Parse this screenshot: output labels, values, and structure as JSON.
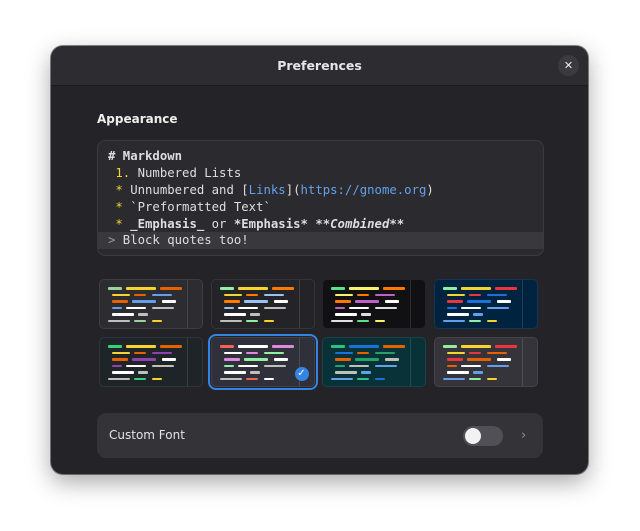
{
  "window": {
    "title": "Preferences",
    "close_icon": "close-icon"
  },
  "appearance": {
    "section_title": "Appearance",
    "preview": {
      "line1": "# Markdown",
      "line2_num": "1.",
      "line2_text": " Numbered Lists",
      "line3_bullet": "*",
      "line3_text_a": " Unnumbered and [",
      "line3_link_text": "Links",
      "line3_text_b": "](",
      "line3_url": "https://gnome.org",
      "line3_text_c": ")",
      "line4_bullet": "*",
      "line4_text": " `Preformatted Text`",
      "line5_bullet": "*",
      "line5_em": " _Emphasis_",
      "line5_or": " or ",
      "line5_strong": "*Emphasis*",
      "line5_combined": " **Combined**",
      "line6_mark": ">",
      "line6_text": " Block quotes too!"
    },
    "schemes": [
      {
        "background": "#2d2d31",
        "selected": false
      },
      {
        "background": "#242428",
        "selected": false
      },
      {
        "background": "#111113",
        "selected": false
      },
      {
        "background": "#002440",
        "selected": false
      },
      {
        "background": "#1f2428",
        "selected": false
      },
      {
        "background": "#30303a",
        "selected": true
      },
      {
        "background": "#083238",
        "selected": false
      },
      {
        "background": "#34343a",
        "selected": false
      }
    ],
    "selected_icon": "checkmark-icon"
  },
  "custom_font": {
    "label": "Custom Font",
    "enabled": false,
    "chevron_icon": "chevron-right-icon"
  }
}
